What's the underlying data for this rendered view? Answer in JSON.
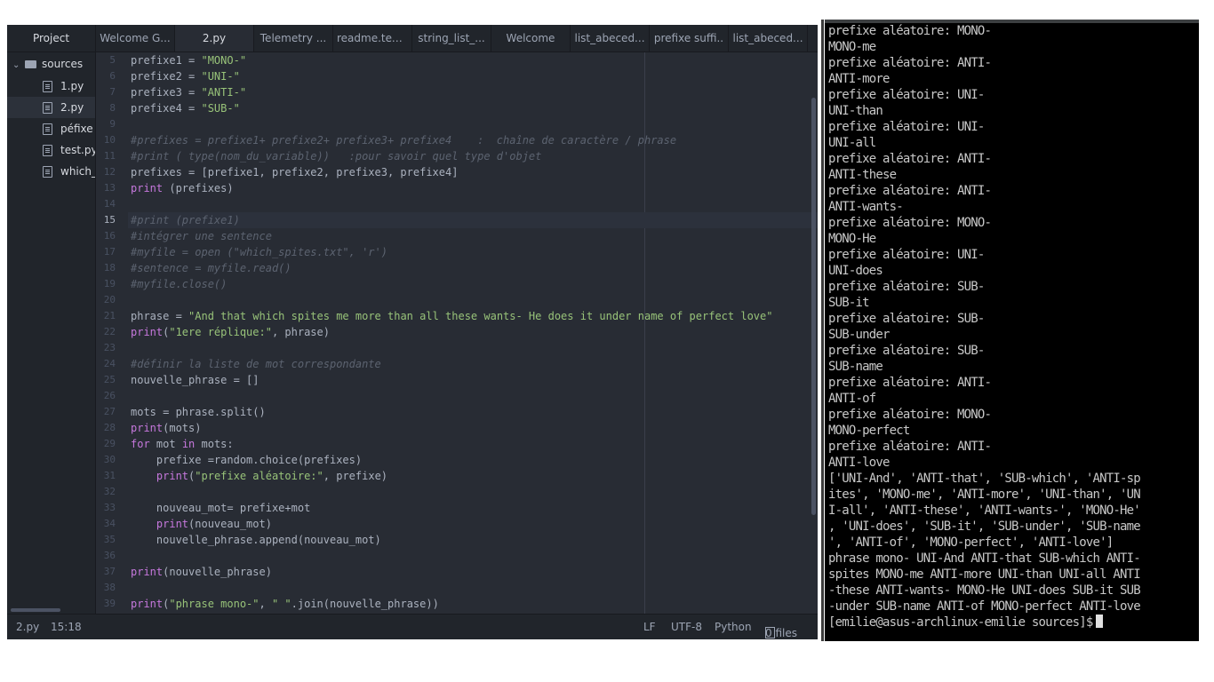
{
  "editor": {
    "project_label": "Project",
    "tabs": [
      {
        "label": "Welcome G...",
        "active": false
      },
      {
        "label": "2.py",
        "active": true
      },
      {
        "label": "Telemetry ...",
        "active": false
      },
      {
        "label": "readme.tex...",
        "active": false
      },
      {
        "label": "string_list_...",
        "active": false
      },
      {
        "label": "Welcome",
        "active": false
      },
      {
        "label": "list_abeced...",
        "active": false
      },
      {
        "label": "prefixe suffi..",
        "active": false
      },
      {
        "label": "list_abeced...",
        "active": false
      }
    ],
    "tree": {
      "folder": "sources",
      "files": [
        {
          "label": "1.py",
          "selected": false
        },
        {
          "label": "2.py",
          "selected": true
        },
        {
          "label": "péfixe s",
          "selected": false
        },
        {
          "label": "test.py",
          "selected": false
        },
        {
          "label": "which_s",
          "selected": false
        }
      ]
    },
    "current_line": 15,
    "code_lines": [
      {
        "n": 5,
        "parts": [
          [
            "",
            "prefixe1 = "
          ],
          [
            "str",
            "\"MONO-\""
          ]
        ]
      },
      {
        "n": 6,
        "parts": [
          [
            "",
            "prefixe2 = "
          ],
          [
            "str",
            "\"UNI-\""
          ]
        ]
      },
      {
        "n": 7,
        "parts": [
          [
            "",
            "prefixe3 = "
          ],
          [
            "str",
            "\"ANTI-\""
          ]
        ]
      },
      {
        "n": 8,
        "parts": [
          [
            "",
            "prefixe4 = "
          ],
          [
            "str",
            "\"SUB-\""
          ]
        ]
      },
      {
        "n": 9,
        "parts": []
      },
      {
        "n": 10,
        "parts": [
          [
            "cm",
            "#prefixes = prefixe1+ prefixe2+ prefixe3+ prefixe4    :  chaîne de caractère / phrase"
          ]
        ]
      },
      {
        "n": 11,
        "parts": [
          [
            "cm",
            "#print ( type(nom_du_variable))   :pour savoir quel type d'objet"
          ]
        ]
      },
      {
        "n": 12,
        "parts": [
          [
            "",
            "prefixes = [prefixe1, prefixe2, prefixe3, prefixe4]"
          ]
        ]
      },
      {
        "n": 13,
        "parts": [
          [
            "kw",
            "print"
          ],
          [
            "",
            " (prefixes)"
          ]
        ]
      },
      {
        "n": 14,
        "parts": []
      },
      {
        "n": 15,
        "parts": [
          [
            "cm",
            "#print (prefixe1)"
          ]
        ]
      },
      {
        "n": 16,
        "parts": [
          [
            "cm",
            "#intégrer une sentence"
          ]
        ]
      },
      {
        "n": 17,
        "parts": [
          [
            "cm",
            "#myfile = open (\"which_spites.txt\", 'r')"
          ]
        ]
      },
      {
        "n": 18,
        "parts": [
          [
            "cm",
            "#sentence = myfile.read()"
          ]
        ]
      },
      {
        "n": 19,
        "parts": [
          [
            "cm",
            "#myfile.close()"
          ]
        ]
      },
      {
        "n": 20,
        "parts": []
      },
      {
        "n": 21,
        "parts": [
          [
            "",
            "phrase = "
          ],
          [
            "str",
            "\"And that which spites me more than all these wants- He does it under name of perfect love\""
          ]
        ]
      },
      {
        "n": 22,
        "parts": [
          [
            "kw",
            "print"
          ],
          [
            "",
            "("
          ],
          [
            "str",
            "\"1ere réplique:\""
          ],
          [
            "",
            ", phrase)"
          ]
        ]
      },
      {
        "n": 23,
        "parts": []
      },
      {
        "n": 24,
        "parts": [
          [
            "cm",
            "#définir la liste de mot correspondante"
          ]
        ]
      },
      {
        "n": 25,
        "parts": [
          [
            "",
            "nouvelle_phrase = []"
          ]
        ]
      },
      {
        "n": 26,
        "parts": []
      },
      {
        "n": 27,
        "parts": [
          [
            "",
            "mots = phrase.split()"
          ]
        ]
      },
      {
        "n": 28,
        "parts": [
          [
            "kw",
            "print"
          ],
          [
            "",
            "(mots)"
          ]
        ]
      },
      {
        "n": 29,
        "parts": [
          [
            "kw",
            "for"
          ],
          [
            "",
            " mot "
          ],
          [
            "kw",
            "in"
          ],
          [
            "",
            " mots:"
          ]
        ]
      },
      {
        "n": 30,
        "parts": [
          [
            "",
            "    prefixe =random.choice(prefixes)"
          ]
        ]
      },
      {
        "n": 31,
        "parts": [
          [
            "",
            "    "
          ],
          [
            "kw",
            "print"
          ],
          [
            "",
            "("
          ],
          [
            "str",
            "\"prefixe aléatoire:\""
          ],
          [
            "",
            ", prefixe)"
          ]
        ]
      },
      {
        "n": 32,
        "parts": []
      },
      {
        "n": 33,
        "parts": [
          [
            "",
            "    nouveau_mot= prefixe+mot"
          ]
        ]
      },
      {
        "n": 34,
        "parts": [
          [
            "",
            "    "
          ],
          [
            "kw",
            "print"
          ],
          [
            "",
            "(nouveau_mot)"
          ]
        ]
      },
      {
        "n": 35,
        "parts": [
          [
            "",
            "    nouvelle_phrase.append(nouveau_mot)"
          ]
        ]
      },
      {
        "n": 36,
        "parts": []
      },
      {
        "n": 37,
        "parts": [
          [
            "kw",
            "print"
          ],
          [
            "",
            "(nouvelle_phrase)"
          ]
        ]
      },
      {
        "n": 38,
        "parts": []
      },
      {
        "n": 39,
        "parts": [
          [
            "kw",
            "print"
          ],
          [
            "",
            "("
          ],
          [
            "str",
            "\"phrase mono-\""
          ],
          [
            "",
            ", "
          ],
          [
            "str",
            "\" \""
          ],
          [
            "",
            ".join(nouvelle_phrase))"
          ]
        ]
      }
    ],
    "status": {
      "file": "2.py",
      "cursor": "15:18",
      "line_ending": "LF",
      "encoding": "UTF-8",
      "grammar": "Python",
      "files": "0 files"
    }
  },
  "terminal": {
    "lines": [
      "prefixe aléatoire: MONO-",
      "MONO-me",
      "prefixe aléatoire: ANTI-",
      "ANTI-more",
      "prefixe aléatoire: UNI-",
      "UNI-than",
      "prefixe aléatoire: UNI-",
      "UNI-all",
      "prefixe aléatoire: ANTI-",
      "ANTI-these",
      "prefixe aléatoire: ANTI-",
      "ANTI-wants-",
      "prefixe aléatoire: MONO-",
      "MONO-He",
      "prefixe aléatoire: UNI-",
      "UNI-does",
      "prefixe aléatoire: SUB-",
      "SUB-it",
      "prefixe aléatoire: SUB-",
      "SUB-under",
      "prefixe aléatoire: SUB-",
      "SUB-name",
      "prefixe aléatoire: ANTI-",
      "ANTI-of",
      "prefixe aléatoire: MONO-",
      "MONO-perfect",
      "prefixe aléatoire: ANTI-",
      "ANTI-love",
      "['UNI-And', 'ANTI-that', 'SUB-which', 'ANTI-sp",
      "ites', 'MONO-me', 'ANTI-more', 'UNI-than', 'UN",
      "I-all', 'ANTI-these', 'ANTI-wants-', 'MONO-He'",
      ", 'UNI-does', 'SUB-it', 'SUB-under', 'SUB-name",
      "', 'ANTI-of', 'MONO-perfect', 'ANTI-love']",
      "phrase mono- UNI-And ANTI-that SUB-which ANTI-",
      "spites MONO-me ANTI-more UNI-than UNI-all ANTI",
      "-these ANTI-wants- MONO-He UNI-does SUB-it SUB",
      "-under SUB-name ANTI-of MONO-perfect ANTI-love"
    ],
    "prompt": "[emilie@asus-archlinux-emilie sources]$"
  }
}
